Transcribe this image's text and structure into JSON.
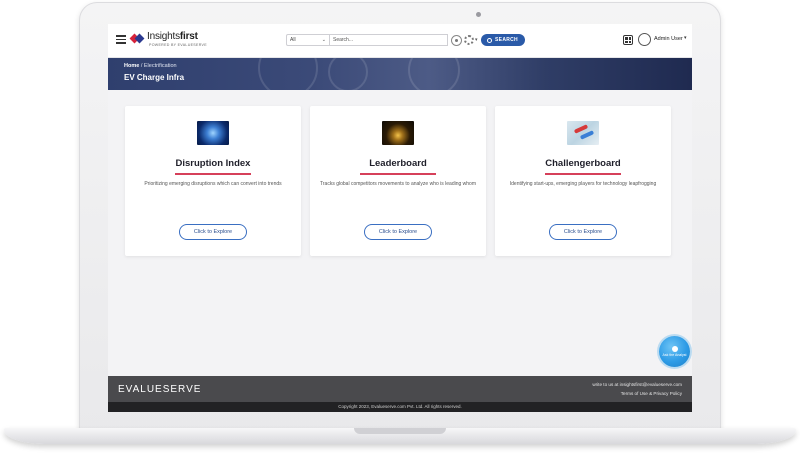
{
  "header": {
    "logo_main": "Insights",
    "logo_bold": "first",
    "logo_sub": "POWERED BY EVALUESERVE",
    "search_scope": "All",
    "search_placeholder": "Search...",
    "search_button": "SEARCH",
    "user_name": "Admin User"
  },
  "banner": {
    "breadcrumb_home": "Home",
    "breadcrumb_separator": "/",
    "breadcrumb_current": "Electrification",
    "title": "EV Charge Infra"
  },
  "cards": [
    {
      "title": "Disruption Index",
      "description": "Prioritizing emerging disruptions which can convert into trends",
      "button": "Click to Explore",
      "thumb": "blue-circuit-brain"
    },
    {
      "title": "Leaderboard",
      "description": "Tracks global competitors movements to analyze who is leading whom",
      "button": "Click to Explore",
      "thumb": "gold-trophy"
    },
    {
      "title": "Challengerboard",
      "description": "Identifying start-ups, emerging players for technology leapfrogging",
      "button": "Click to Explore",
      "thumb": "red-blue-arrows"
    }
  ],
  "fab": {
    "label": "Ask the Analyst"
  },
  "footer": {
    "brand": "EVALUESERVE",
    "contact": "write to us at insightsfirst@evalueserve.com",
    "links": "Terms of Use & Privacy Policy",
    "copyright": "Copyright 2023, Evalueserve.com Pvt. Ltd. All rights reserved."
  },
  "colors": {
    "accent": "#2a5aa8",
    "card_rule": "#d6405a",
    "footer": "#4a4a4d",
    "banner": "#2f3f6e"
  }
}
